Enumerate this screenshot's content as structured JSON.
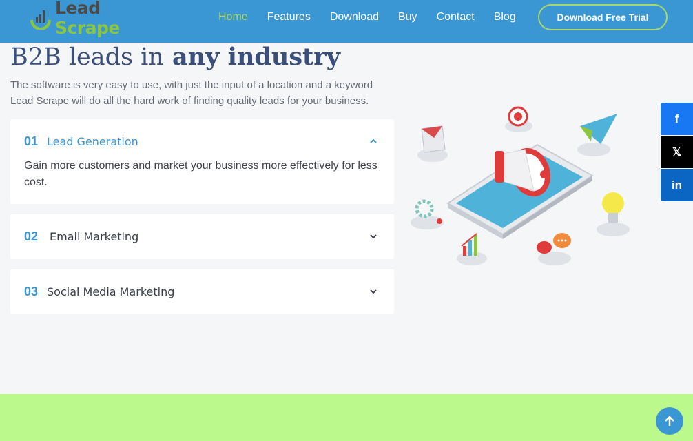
{
  "header": {
    "logo": {
      "word1": "Lead",
      "word2": "Scrape"
    },
    "nav": [
      "Home",
      "Features",
      "Download",
      "Buy",
      "Contact",
      "Blog"
    ],
    "active_nav": "Home",
    "cta": "Download Free Trial"
  },
  "hero": {
    "title_plain": "B2B leads in",
    "title_bold": "any industry",
    "description": "The software is very easy to use, with just the input of a location and a keyword Lead Scrape will do all the hard work of finding quality leads for your business."
  },
  "accordion": [
    {
      "num": "01",
      "title": "Lead Generation",
      "expanded": true,
      "body": "Gain more customers and market your business more effectively for less cost."
    },
    {
      "num": "02",
      "title": "Email Marketing",
      "expanded": false
    },
    {
      "num": "03",
      "title": "Social Media Marketing",
      "expanded": false
    }
  ],
  "share": [
    {
      "name": "facebook",
      "glyph": "f"
    },
    {
      "name": "x",
      "glyph": "𝕏"
    },
    {
      "name": "linkedin",
      "glyph": "in"
    }
  ],
  "colors": {
    "primary": "#3b97d3",
    "accent": "#a8d86a",
    "band": "#bbf98d"
  }
}
